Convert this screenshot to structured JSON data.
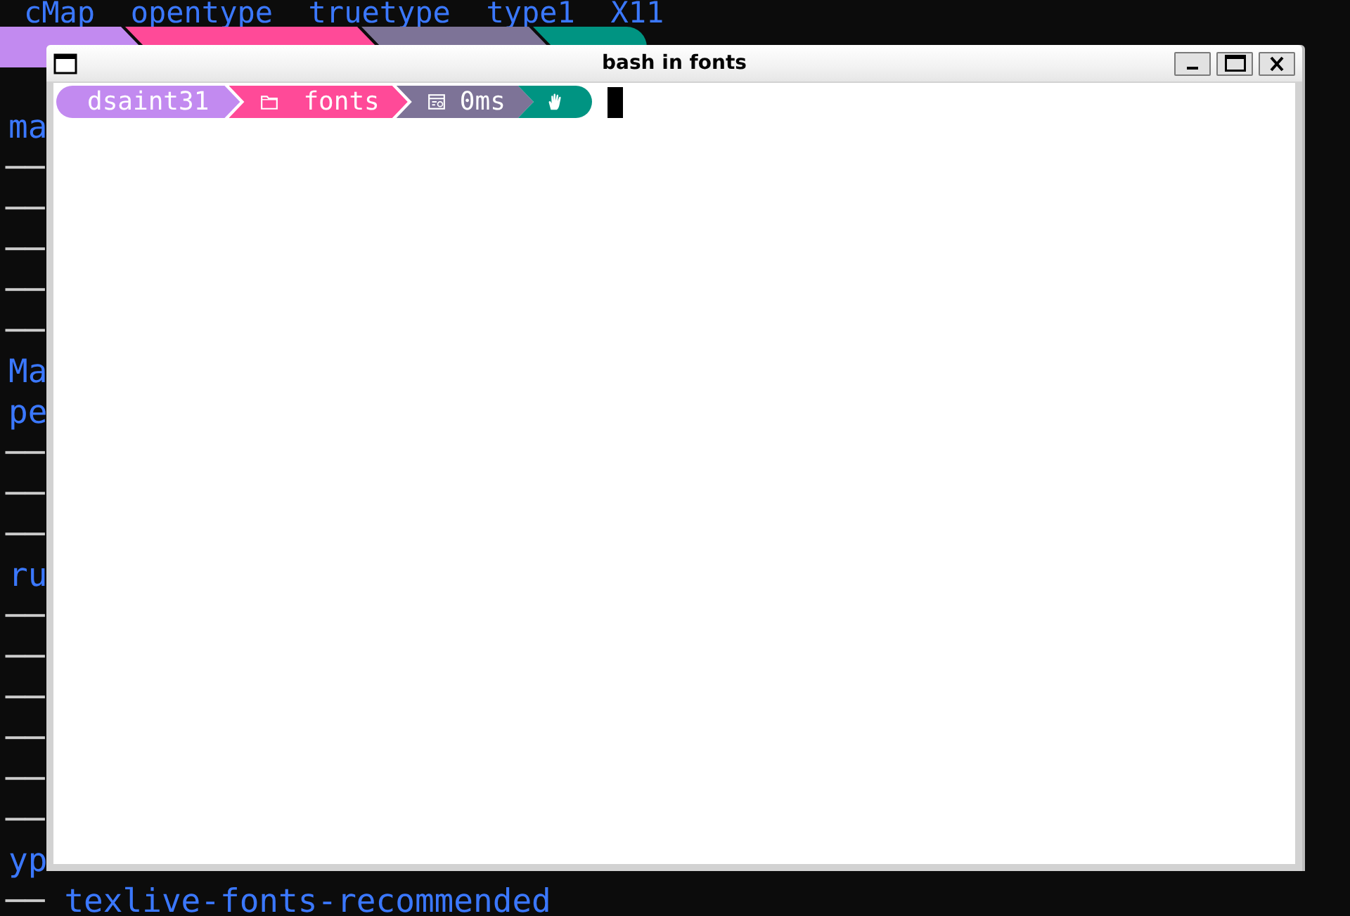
{
  "background_terminal": {
    "rows": [
      {
        "kind": "words",
        "text": "cMap  opentype  truetype  type1  X11"
      },
      {
        "kind": "prompt",
        "segments": [
          {
            "kind": "user",
            "color": "#c28af0"
          },
          {
            "kind": "directory",
            "color": "#ff4a98"
          },
          {
            "kind": "duration",
            "color": "#7d7397"
          },
          {
            "kind": "status",
            "color": "#009482"
          }
        ]
      },
      {
        "kind": "blank"
      },
      {
        "kind": "fragment",
        "text": "ma"
      },
      {
        "kind": "branch",
        "branch": "──"
      },
      {
        "kind": "branch",
        "branch": "──"
      },
      {
        "kind": "branch",
        "branch": "──"
      },
      {
        "kind": "branch",
        "branch": "──"
      },
      {
        "kind": "branch",
        "branch": "──"
      },
      {
        "kind": "fragment",
        "text": "Ma"
      },
      {
        "kind": "fragment",
        "text": "pe"
      },
      {
        "kind": "branch",
        "branch": "──"
      },
      {
        "kind": "branch",
        "branch": "──"
      },
      {
        "kind": "branch",
        "branch": "──"
      },
      {
        "kind": "fragment",
        "text": "ru"
      },
      {
        "kind": "branch",
        "branch": "──"
      },
      {
        "kind": "branch",
        "branch": "──"
      },
      {
        "kind": "branch",
        "branch": "──"
      },
      {
        "kind": "branch",
        "branch": "──"
      },
      {
        "kind": "branch",
        "branch": "──"
      },
      {
        "kind": "branch",
        "branch": "──"
      },
      {
        "kind": "fragment",
        "text": "yp"
      },
      {
        "kind": "branch_entry",
        "branch": "──",
        "text": "texlive-fonts-recommended"
      }
    ]
  },
  "window": {
    "title": "bash in fonts",
    "buttons": [
      {
        "kind": "minimize"
      },
      {
        "kind": "maximize"
      },
      {
        "kind": "close"
      }
    ],
    "prompt": {
      "segments": [
        {
          "kind": "user",
          "text": "dsaint31",
          "color": "#c28af0"
        },
        {
          "kind": "directory",
          "text": "fonts",
          "color": "#ff4a98"
        },
        {
          "kind": "duration",
          "text": "0ms",
          "color": "#7d7397"
        },
        {
          "kind": "status",
          "color": "#009482"
        }
      ],
      "cursor_visible": true
    }
  }
}
